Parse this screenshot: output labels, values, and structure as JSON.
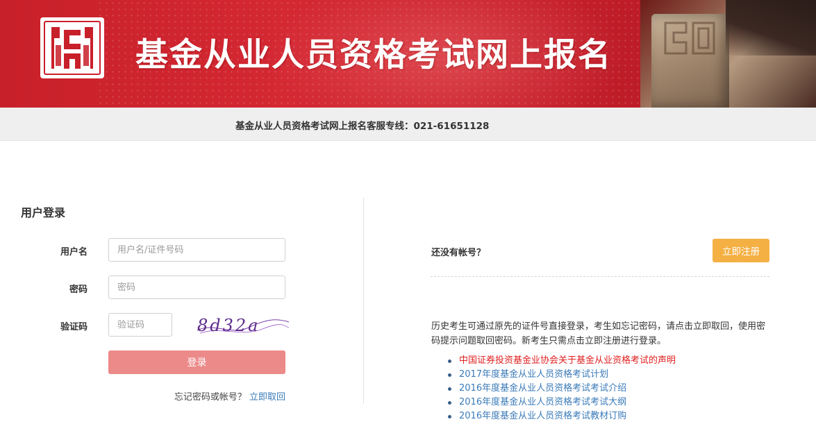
{
  "banner": {
    "title": "基金从业人员资格考试网上报名",
    "logo_icon": "fund-association-logo-icon",
    "seal_image": "stone-seal-photo"
  },
  "hotline": {
    "text": "基金从业人员资格考试网上报名客服专线：021-61651128"
  },
  "login": {
    "title": "用户登录",
    "username_label": "用户名",
    "username_placeholder": "用户名/证件号码",
    "password_label": "密码",
    "password_placeholder": "密码",
    "captcha_label": "验证码",
    "captcha_placeholder": "验证码",
    "captcha_text": "8d32a",
    "submit_label": "登录",
    "forgot_text": "忘记密码或帐号？",
    "forgot_link": "立即取回"
  },
  "register": {
    "prompt": "还没有帐号？",
    "button_label": "立即注册",
    "notice": "历史考生可通过原先的证件号直接登录，考生如忘记密码，请点击立即取回，使用密码提示问题取回密码。新考生只需点击立即注册进行登录。",
    "links": [
      {
        "text": "中国证券投资基金业协会关于基金从业资格考试的声明",
        "highlight": true
      },
      {
        "text": "2017年度基金从业人员资格考试计划",
        "highlight": false
      },
      {
        "text": "2016年度基金从业人员资格考试考试介绍",
        "highlight": false
      },
      {
        "text": "2016年度基金从业人员资格考试考试大纲",
        "highlight": false
      },
      {
        "text": "2016年度基金从业人员资格考试教材订购",
        "highlight": false
      }
    ]
  },
  "colors": {
    "banner_red": "#d42833",
    "login_button": "#ec8a8a",
    "register_button": "#f5b044",
    "link_blue": "#3a7ab8",
    "link_red": "#e02020"
  }
}
